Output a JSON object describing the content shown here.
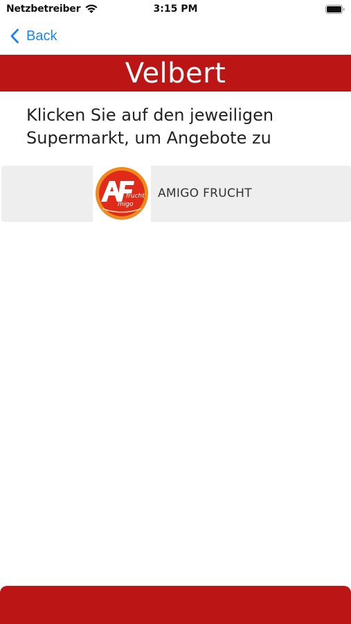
{
  "status_bar": {
    "carrier": "Netzbetreiber",
    "time": "3:15 PM",
    "icons": [
      "wifi-icon",
      "battery-icon"
    ]
  },
  "nav": {
    "back_label": "Back",
    "back_icon": "chevron-left-icon",
    "accent_color": "#1a84ee"
  },
  "header": {
    "title": "Velbert",
    "background_color": "#bb1516"
  },
  "instruction": "Klicken Sie auf den jeweiligen Supermarkt, um Angebote zu",
  "markets": [
    {
      "name": "AMIGO FRUCHT",
      "logo": "amigo-frucht-logo"
    }
  ],
  "footer": {
    "background_color": "#bb1516"
  }
}
